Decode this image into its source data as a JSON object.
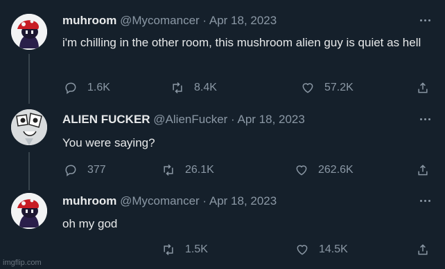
{
  "tweets": [
    {
      "name": "muhroom",
      "handle": "@Mycomancer",
      "date": "Apr 18, 2023",
      "text": "i'm chilling in the other room, this mushroom alien guy is quiet as hell",
      "replies": "1.6K",
      "retweets": "8.4K",
      "likes": "57.2K"
    },
    {
      "name": "ALIEN FUCKER",
      "handle": "@AlienFucker",
      "date": "Apr 18, 2023",
      "text": "You were saying?",
      "replies": "377",
      "retweets": "26.1K",
      "likes": "262.6K"
    },
    {
      "name": "muhroom",
      "handle": "@Mycomancer",
      "date": "Apr 18, 2023",
      "text": "oh my god",
      "replies": "",
      "retweets": "1.5K",
      "likes": "14.5K"
    }
  ],
  "separator": " · ",
  "icons": {
    "reply": "reply-icon",
    "retweet": "retweet-icon",
    "like": "heart-icon",
    "share": "share-icon",
    "more": "more-icon"
  },
  "watermark": "imgflip.com",
  "colors": {
    "background": "#15202b",
    "text": "#e7e9ea",
    "muted": "#8b98a5",
    "thread_line": "#38444d"
  }
}
